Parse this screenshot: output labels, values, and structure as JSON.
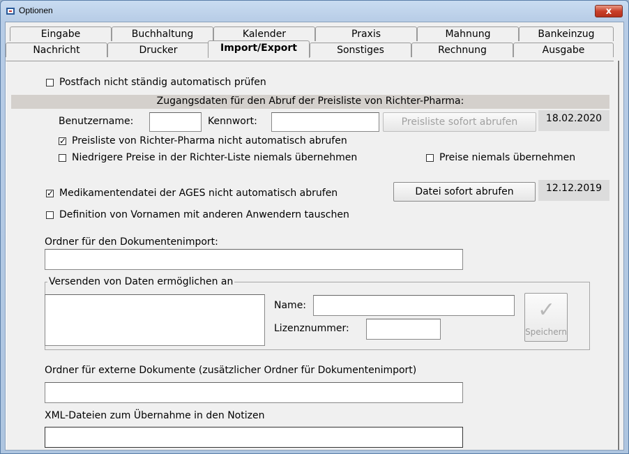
{
  "window": {
    "title": "Optionen",
    "close_label": "x"
  },
  "tabs_row1": [
    "Eingabe",
    "Buchhaltung",
    "Kalender",
    "Praxis",
    "Mahnung",
    "Bankeinzug"
  ],
  "tabs_row2": [
    "Nachricht",
    "Drucker",
    "Import/Export",
    "Sonstiges",
    "Rechnung",
    "Ausgabe"
  ],
  "active_tab": "Import/Export",
  "postfach": {
    "label": "Postfach nicht ständig automatisch prüfen",
    "checked": false
  },
  "richter": {
    "section_title": "Zugangsdaten für den Abruf der Preisliste von Richter-Pharma:",
    "username_label": "Benutzername:",
    "username_value": "",
    "password_label": "Kennwort:",
    "password_value": "",
    "fetch_button": "Preisliste sofort abrufen",
    "date": "18.02.2020",
    "no_auto": {
      "label": "Preisliste von Richter-Pharma nicht automatisch abrufen",
      "checked": true
    },
    "lower_prices": {
      "label": "Niedrigere Preise in der Richter-Liste niemals übernehmen",
      "checked": false
    },
    "never_prices": {
      "label": "Preise niemals übernehmen",
      "checked": false
    }
  },
  "ages": {
    "label": "Medikamentendatei der AGES nicht automatisch abrufen",
    "checked": true,
    "button": "Datei sofort abrufen",
    "date": "12.12.2019"
  },
  "vornamen": {
    "label": "Definition von Vornamen mit anderen Anwendern tauschen",
    "checked": false
  },
  "doc_import": {
    "label": "Ordner für den Dokumentenimport:",
    "value": ""
  },
  "send_group": {
    "title": "Versenden von Daten ermöglichen an",
    "name_label": "Name:",
    "name_value": "",
    "license_label": "Lizenznummer:",
    "license_value": "",
    "save_label": "Speichern"
  },
  "external_docs": {
    "label": "Ordner für externe Dokumente (zusätzlicher Ordner für Dokumentenimport)",
    "value": ""
  },
  "xml_files": {
    "label": "XML-Dateien zum Übernahme in den Notizen",
    "value": ""
  }
}
